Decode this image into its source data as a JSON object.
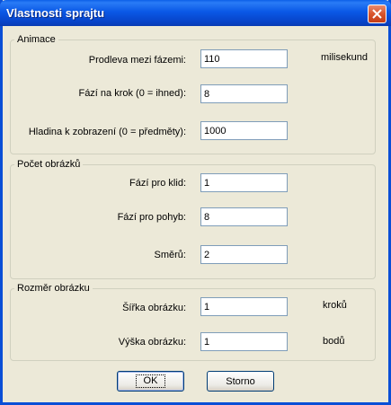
{
  "window": {
    "title": "Vlastnosti sprajtu",
    "close_icon": "close-icon"
  },
  "animace": {
    "legend": "Animace",
    "prodleva": {
      "label": "Prodleva mezi fázemi:",
      "value": "110",
      "unit": "milisekund"
    },
    "faze_krok": {
      "label": "Fází na krok (0 = ihned):",
      "value": "8"
    },
    "hladina": {
      "label": "Hladina k zobrazení (0 = předměty):",
      "value": "1000"
    }
  },
  "pocet": {
    "legend": "Počet obrázků",
    "klid": {
      "label": "Fází pro klid:",
      "value": "1"
    },
    "pohyb": {
      "label": "Fází pro pohyb:",
      "value": "8"
    },
    "smeru": {
      "label": "Směrů:",
      "value": "2"
    }
  },
  "rozmer": {
    "legend": "Rozměr obrázku",
    "sirka": {
      "label": "Šířka obrázku:",
      "value": "1",
      "unit": "kroků"
    },
    "vyska": {
      "label": "Výška obrázku:",
      "value": "1",
      "unit": "bodů"
    }
  },
  "buttons": {
    "ok": "OK",
    "cancel": "Storno"
  },
  "colors": {
    "titlebar": "#0a58e6",
    "dialog_bg": "#ece9d8",
    "close_button": "#d9542b"
  }
}
